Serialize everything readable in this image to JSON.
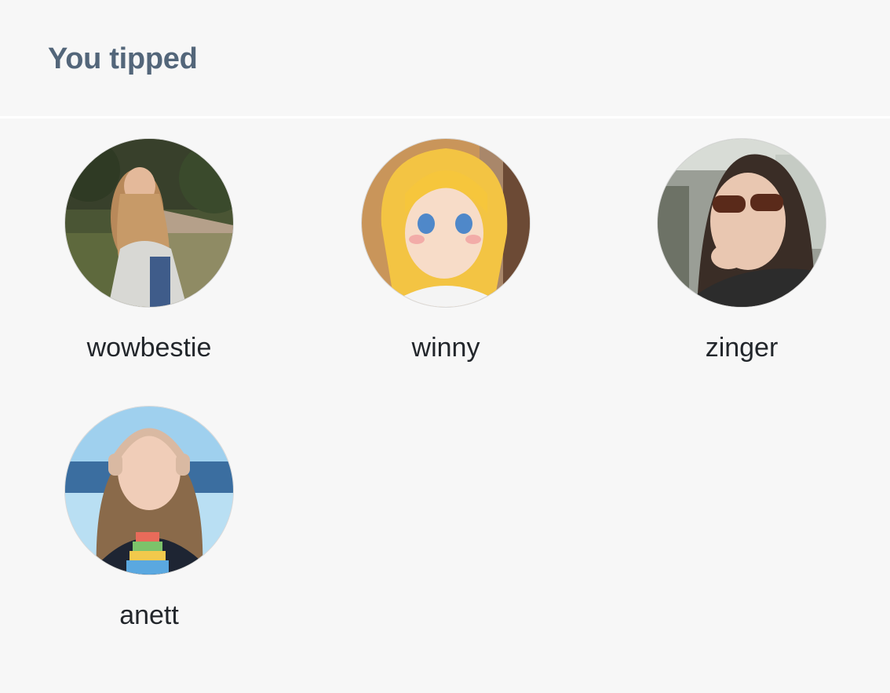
{
  "header": {
    "title": "You tipped"
  },
  "creators": [
    {
      "name": "wowbestie"
    },
    {
      "name": "winny"
    },
    {
      "name": "zinger"
    },
    {
      "name": "anett"
    }
  ],
  "colors": {
    "background": "#f7f7f7",
    "title": "#53667a",
    "name": "#22262b",
    "divider": "#ffffff"
  }
}
